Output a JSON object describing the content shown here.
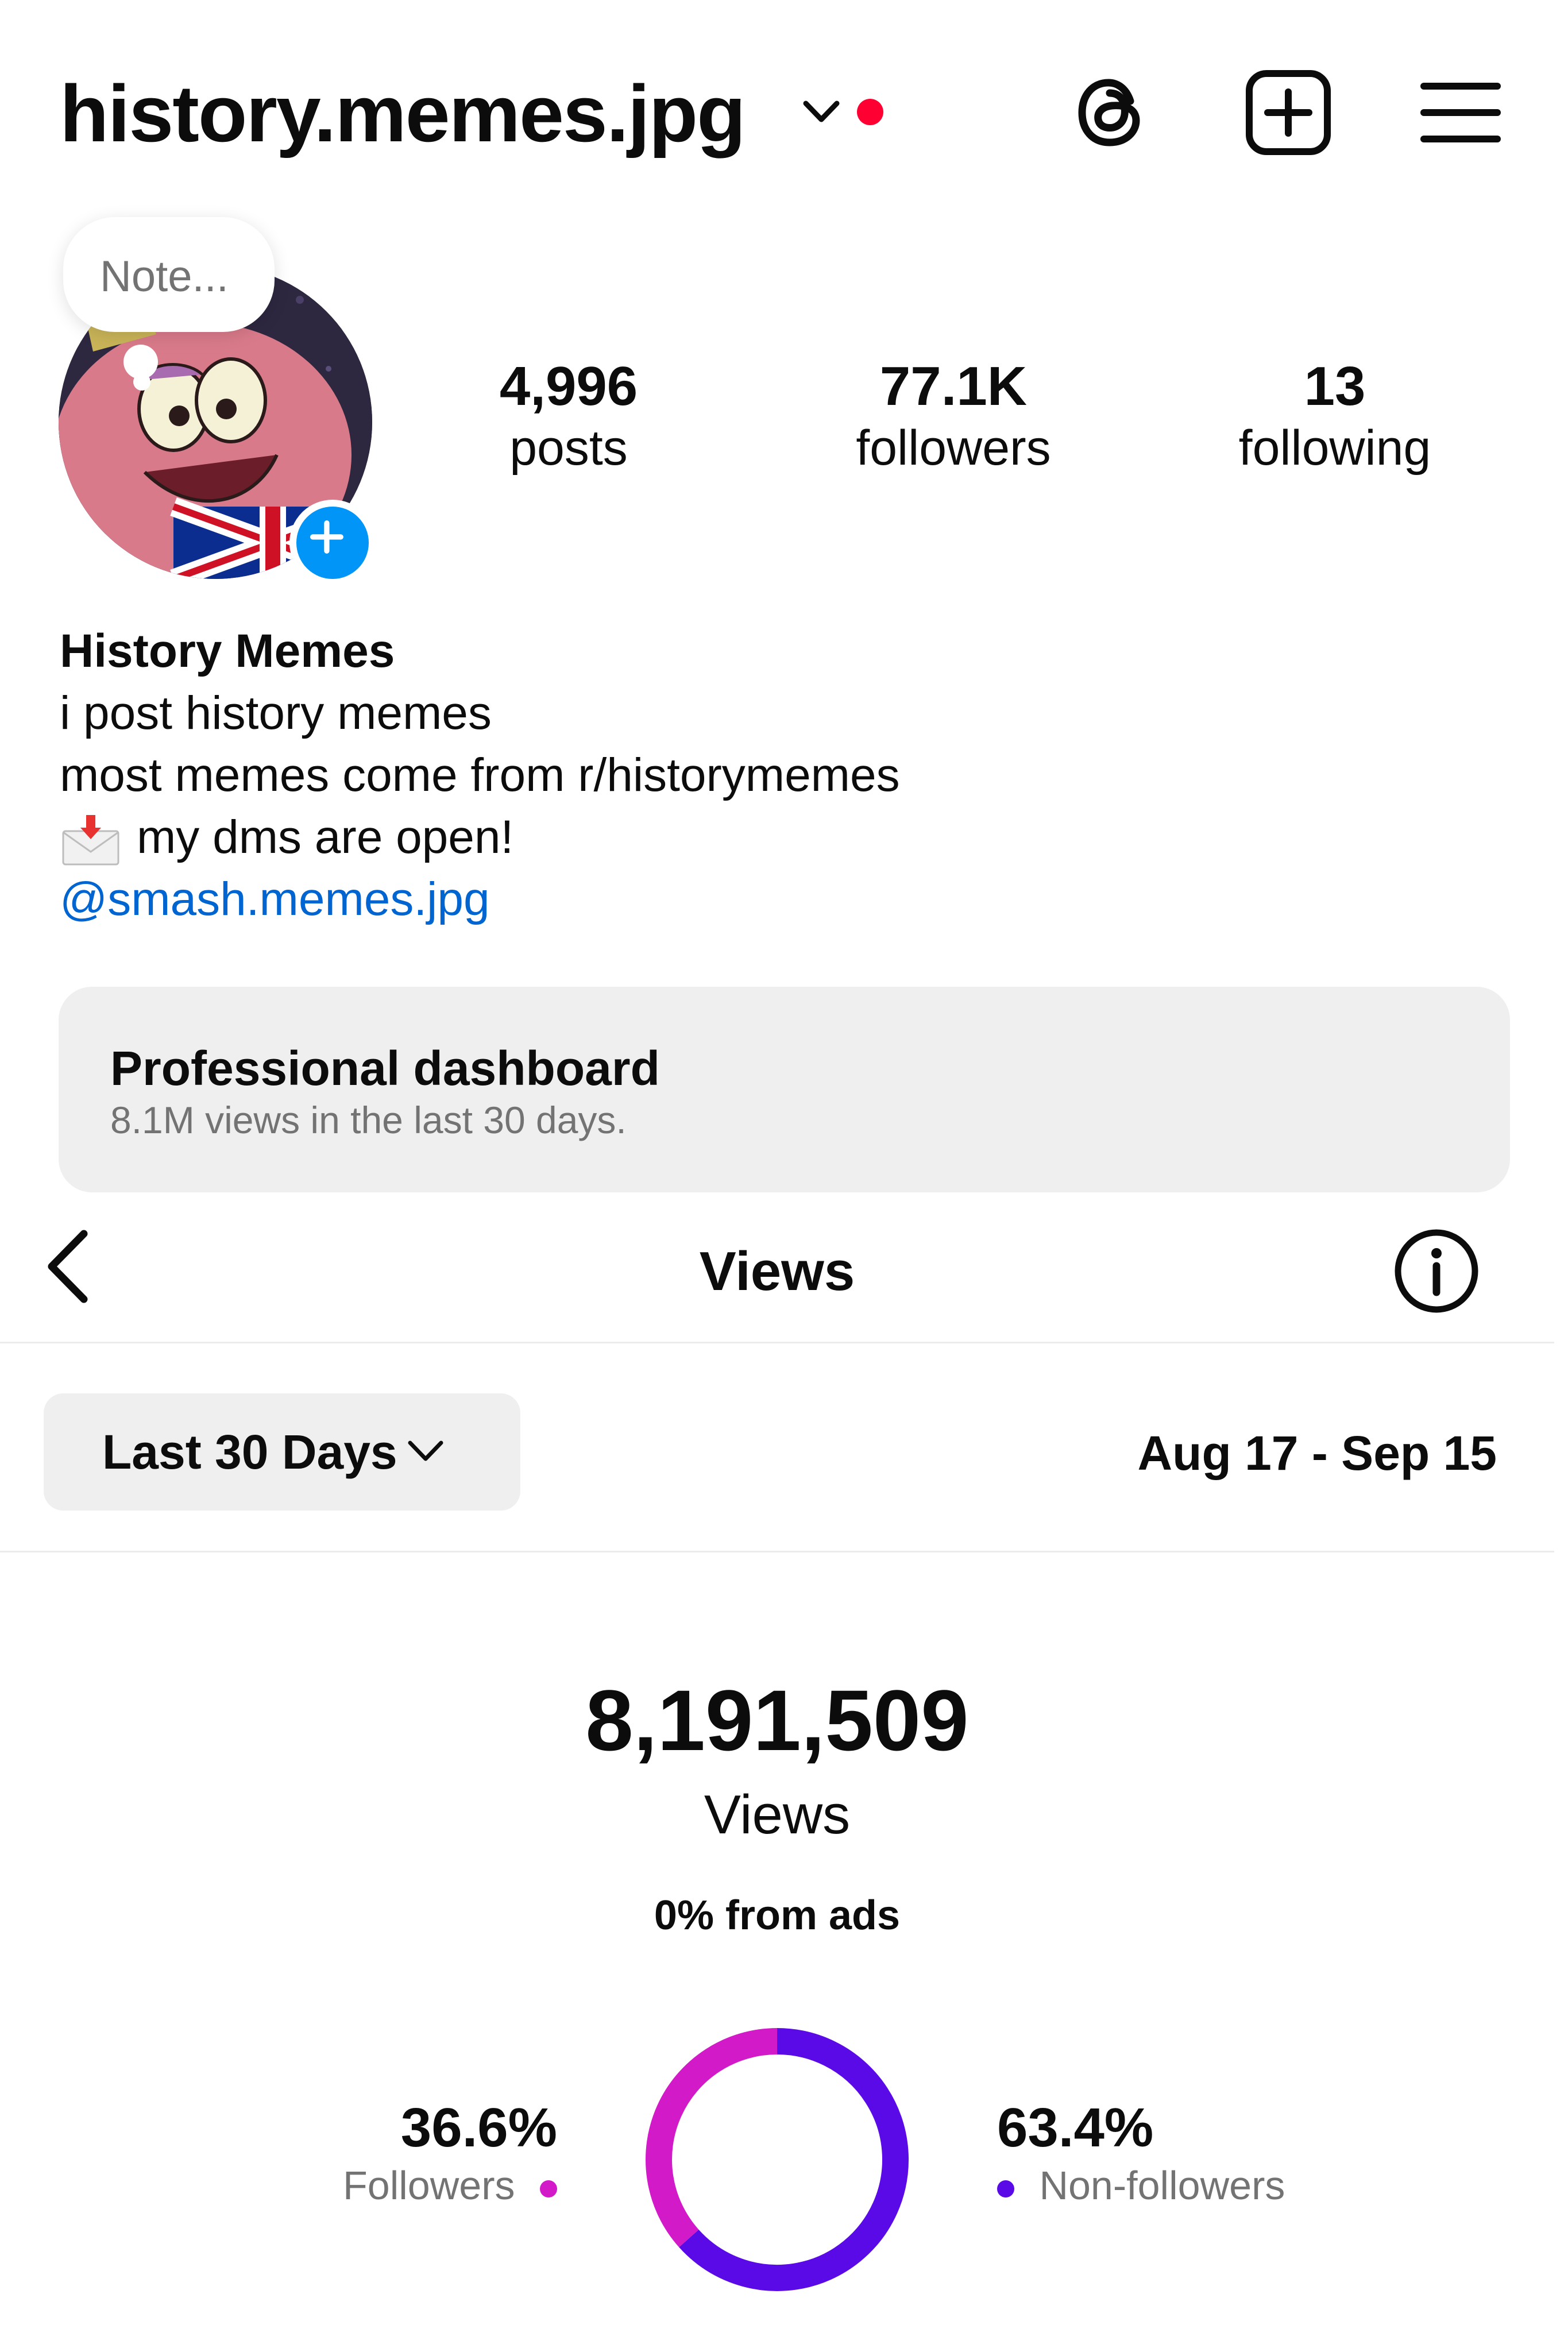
{
  "header": {
    "username": "history.memes.jpg",
    "icons": [
      "chevron-down-icon",
      "threads-icon",
      "create-icon",
      "menu-icon"
    ]
  },
  "profile": {
    "note_placeholder": "Note...",
    "stats": [
      {
        "value": "4,996",
        "label": "posts"
      },
      {
        "value": "77.1K",
        "label": "followers"
      },
      {
        "value": "13",
        "label": "following"
      }
    ],
    "name": "History Memes",
    "bio": [
      "i post history memes",
      "most memes come from r/historymemes",
      "my dms are open!"
    ],
    "link": "@smash.memes.jpg"
  },
  "dashboard": {
    "title": "Professional dashboard",
    "subtitle": "8.1M views in the last 30 days."
  },
  "views_page": {
    "title": "Views",
    "range_label": "Last 30 Days",
    "date_range": "Aug 17 - Sep 15",
    "total": "8,191,509",
    "total_label": "Views",
    "ads_text": "0% from ads"
  },
  "chart_data": {
    "type": "pie",
    "categories": [
      "Followers",
      "Non-followers"
    ],
    "values": [
      36.6,
      63.4
    ],
    "labels": [
      "36.6%",
      "63.4%"
    ],
    "colors": [
      "#d21ac8",
      "#5a0ae6"
    ]
  },
  "colors": {
    "accent_blue": "#0095f6",
    "link": "#0064d1",
    "notification_red": "#ff0033"
  }
}
